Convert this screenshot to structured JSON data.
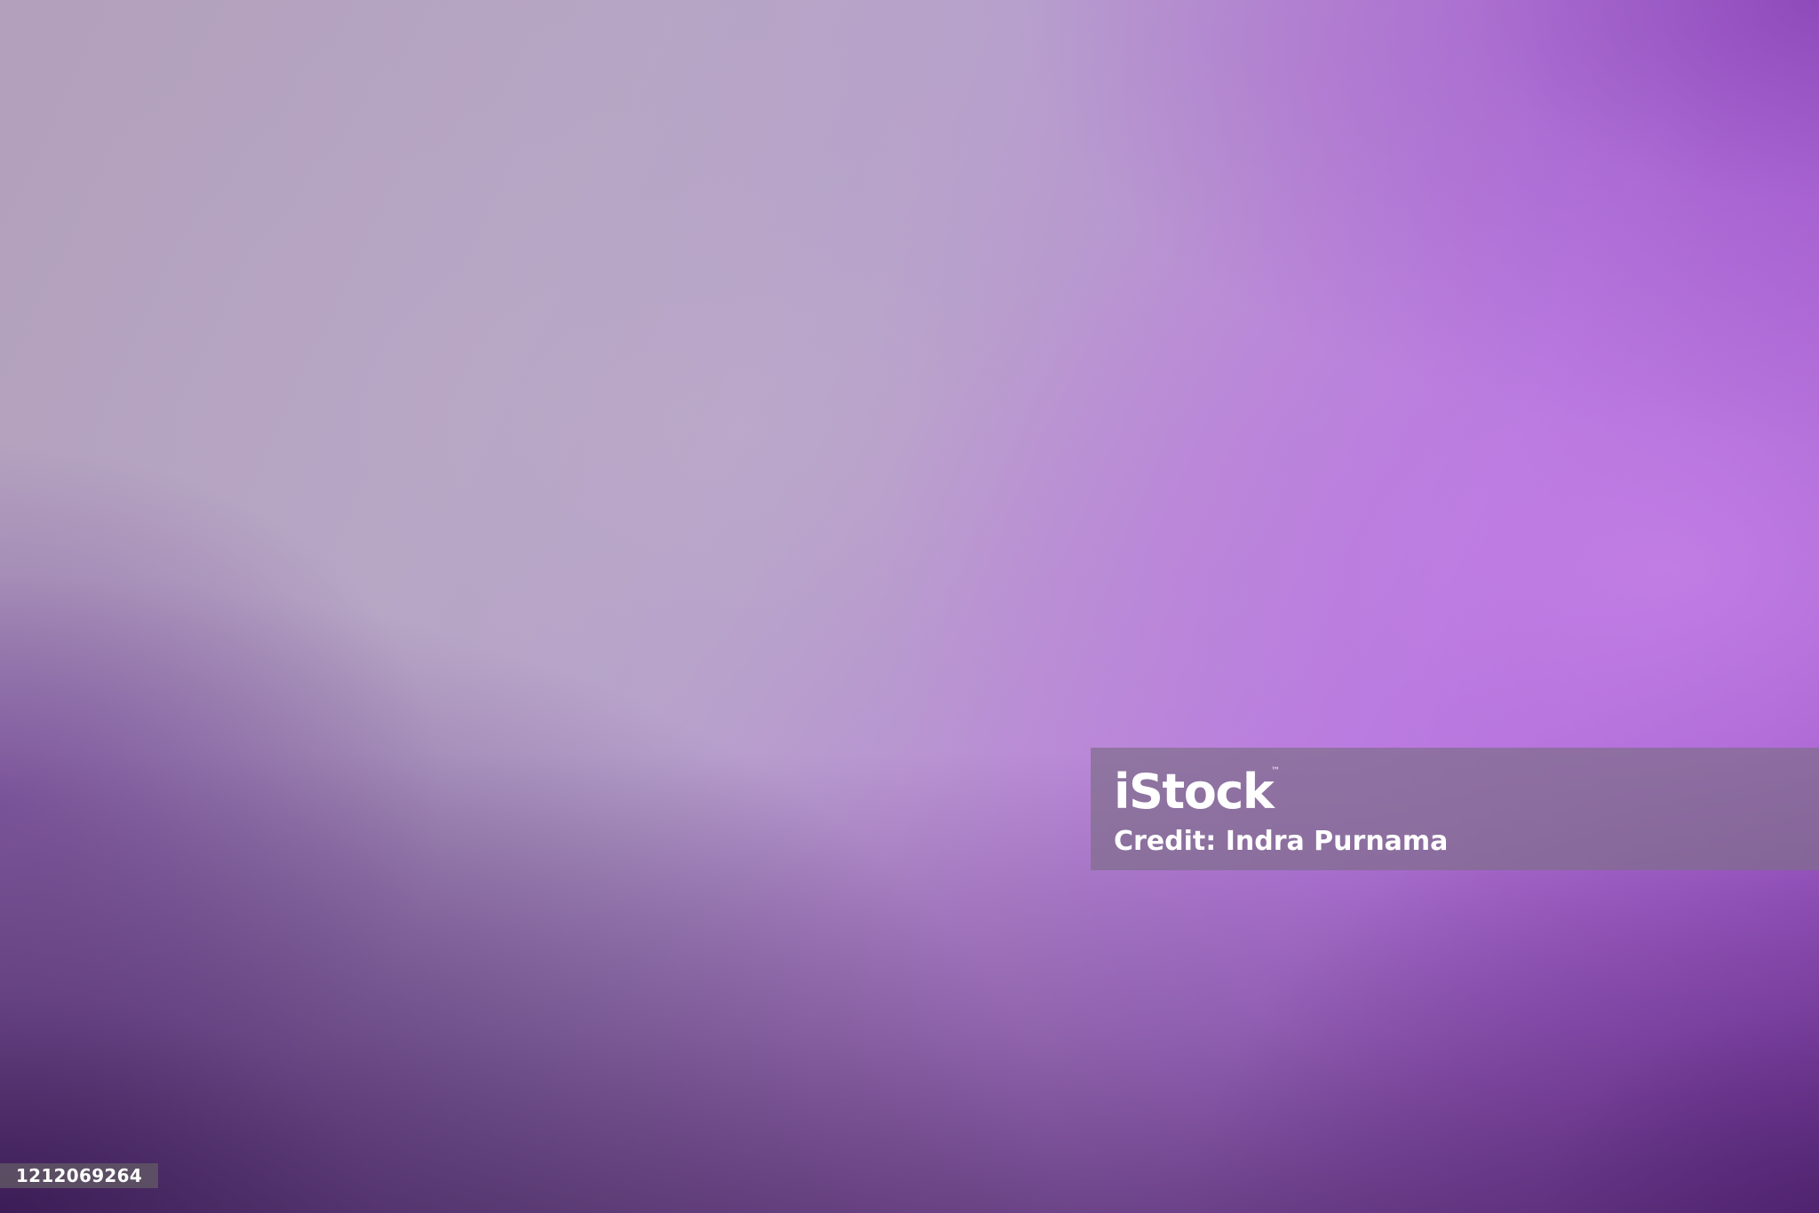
{
  "image": {
    "description_colors": {
      "pale": "#b4a3c2",
      "violet": "#bd7ae0",
      "deep_purple": "#3c1a5c"
    }
  },
  "watermark": {
    "brand": "iStock",
    "trademark": "™",
    "credit": "Credit: Indra Purnama"
  },
  "image_id": "1212069264"
}
